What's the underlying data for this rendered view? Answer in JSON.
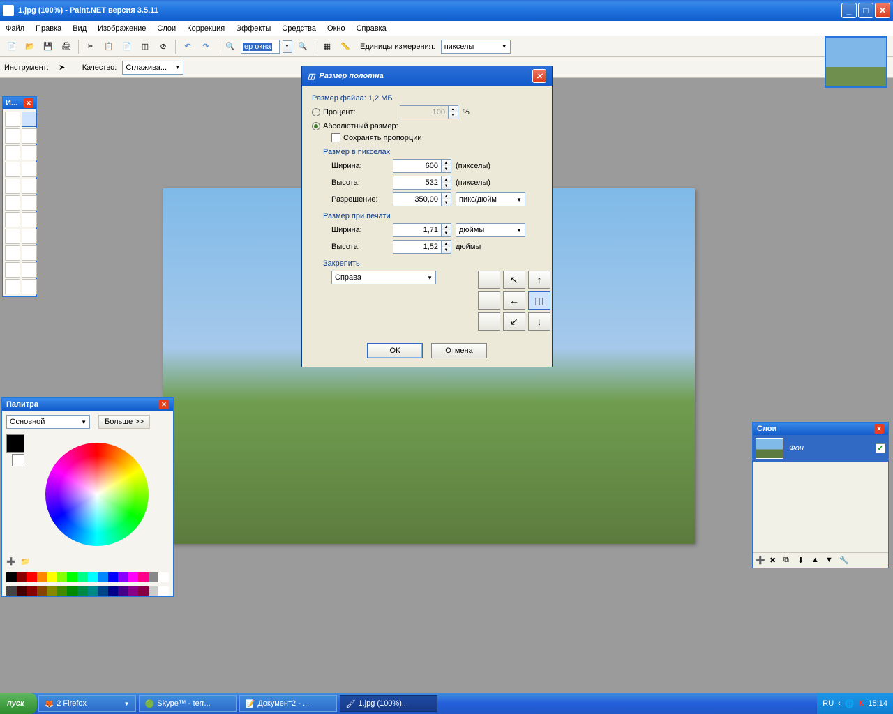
{
  "window": {
    "title": "1.jpg (100%) - Paint.NET версия 3.5.11"
  },
  "menu": {
    "file": "Файл",
    "edit": "Правка",
    "view": "Вид",
    "image": "Изображение",
    "layers": "Слои",
    "adjustments": "Коррекция",
    "effects": "Эффекты",
    "tools": "Средства",
    "window": "Окно",
    "help": "Справка"
  },
  "toolbar": {
    "zoom_value": "ер окна",
    "units_label": "Единицы измерения:",
    "units_value": "пикселы",
    "tool_label": "Инструмент:",
    "quality_label": "Качество:",
    "quality_value": "Сглажива..."
  },
  "tools_panel": {
    "title": "И..."
  },
  "palette": {
    "title": "Палитра",
    "mode": "Основной",
    "more": "Больше >>"
  },
  "layers": {
    "title": "Слои",
    "layer_name": "Фон"
  },
  "dialog": {
    "title": "Размер полотна",
    "file_size_label": "Размер файла: 1,2 МБ",
    "percent_label": "Процент:",
    "percent_value": "100",
    "percent_unit": "%",
    "absolute_label": "Абсолютный размер:",
    "maintain_aspect": "Сохранять пропорции",
    "pixel_size_header": "Размер в пикселах",
    "width_label": "Ширина:",
    "height_label": "Высота:",
    "resolution_label": "Разрешение:",
    "width_px": "600",
    "height_px": "532",
    "resolution": "350,00",
    "px_unit": "(пикселы)",
    "res_unit": "пикс/дюйм",
    "print_size_header": "Размер при печати",
    "width_print": "1,71",
    "height_print": "1,52",
    "print_unit": "дюймы",
    "anchor_header": "Закрепить",
    "anchor_value": "Справа",
    "ok": "ОК",
    "cancel": "Отмена"
  },
  "taskbar": {
    "start": "пуск",
    "firefox": "2 Firefox",
    "skype": "Skype™ - terr...",
    "word": "Документ2 - ...",
    "paint": "1.jpg (100%)...",
    "lang": "RU",
    "clock": "15:14"
  }
}
